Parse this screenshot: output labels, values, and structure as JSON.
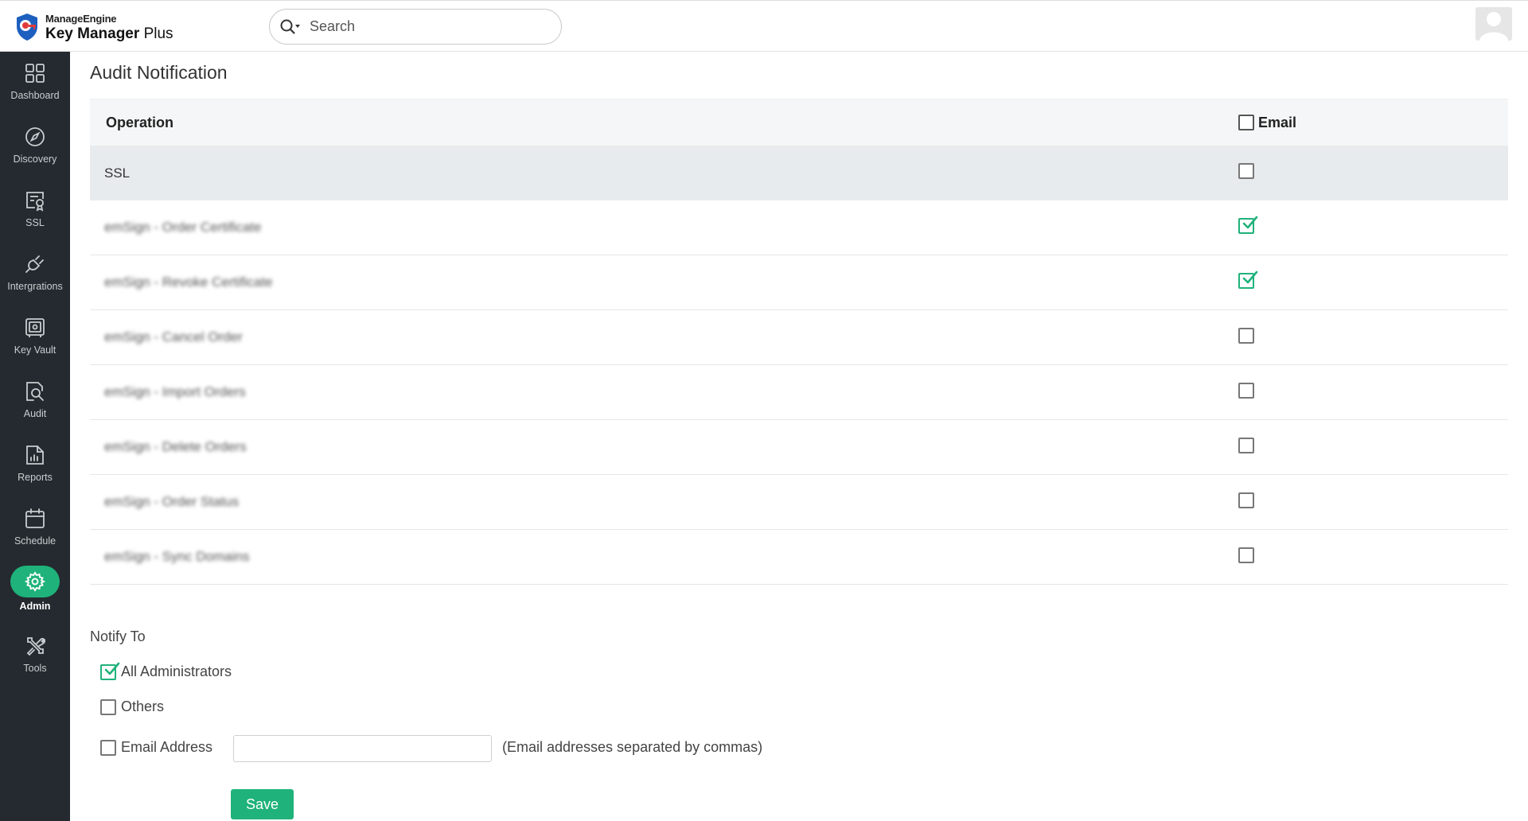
{
  "header": {
    "brand": "ManageEngine",
    "product_main": "Key Manager",
    "product_suffix": "Plus",
    "search_placeholder": "Search"
  },
  "sidebar": {
    "items": [
      {
        "label": "Dashboard",
        "icon": "dashboard-icon"
      },
      {
        "label": "Discovery",
        "icon": "compass-icon"
      },
      {
        "label": "SSL",
        "icon": "certificate-icon"
      },
      {
        "label": "Intergrations",
        "icon": "plug-icon"
      },
      {
        "label": "Key Vault",
        "icon": "vault-icon"
      },
      {
        "label": "Audit",
        "icon": "audit-icon"
      },
      {
        "label": "Reports",
        "icon": "report-icon"
      },
      {
        "label": "Schedule",
        "icon": "calendar-icon"
      },
      {
        "label": "Admin",
        "icon": "gear-icon",
        "active": true
      },
      {
        "label": "Tools",
        "icon": "tools-icon"
      }
    ]
  },
  "page": {
    "title": "Audit Notification"
  },
  "table": {
    "col_operation": "Operation",
    "col_email": "Email",
    "rows": [
      {
        "label": "SSL",
        "email": false,
        "blurred": false
      },
      {
        "label": "emSign - Order Certificate",
        "email": true,
        "blurred": true
      },
      {
        "label": "emSign - Revoke Certificate",
        "email": true,
        "blurred": true
      },
      {
        "label": "emSign - Cancel Order",
        "email": false,
        "blurred": true
      },
      {
        "label": "emSign - Import Orders",
        "email": false,
        "blurred": true
      },
      {
        "label": "emSign - Delete Orders",
        "email": false,
        "blurred": true
      },
      {
        "label": "emSign - Order Status",
        "email": false,
        "blurred": true
      },
      {
        "label": "emSign - Sync Domains",
        "email": false,
        "blurred": true
      }
    ]
  },
  "notify": {
    "title": "Notify To",
    "all_admins": "All Administrators",
    "all_admins_checked": true,
    "others": "Others",
    "others_checked": false,
    "email_address": "Email Address",
    "email_address_checked": false,
    "email_value": "",
    "email_hint": "(Email addresses separated by commas)",
    "save_label": "Save"
  },
  "colors": {
    "accent": "#1fb27a",
    "sidebar_bg": "#242a2f",
    "row_highlight": "#e8ebee"
  }
}
